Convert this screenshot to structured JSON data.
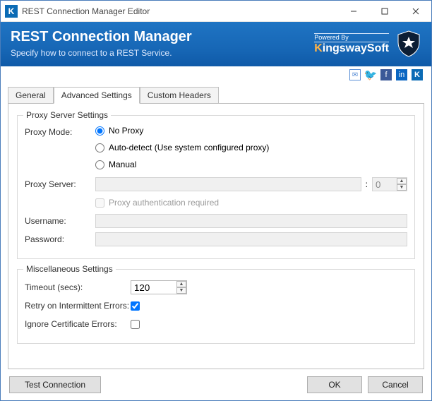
{
  "window": {
    "title": "REST Connection Manager Editor"
  },
  "header": {
    "title": "REST Connection Manager",
    "subtitle": "Specify how to connect to a REST Service.",
    "powered_prefix": "Powered By",
    "brand_accent": "K",
    "brand_rest": "ingswaySoft"
  },
  "tabs": {
    "general": "General",
    "advanced": "Advanced Settings",
    "custom": "Custom Headers"
  },
  "proxy": {
    "legend": "Proxy Server Settings",
    "mode_label": "Proxy Mode:",
    "opt_no_proxy": "No Proxy",
    "opt_autodetect": "Auto-detect (Use system configured proxy)",
    "opt_manual": "Manual",
    "server_label": "Proxy Server:",
    "server_value": "",
    "port_sep": ":",
    "port_value": "0",
    "auth_required": "Proxy authentication required",
    "username_label": "Username:",
    "username_value": "",
    "password_label": "Password:",
    "password_value": ""
  },
  "misc": {
    "legend": "Miscellaneous Settings",
    "timeout_label": "Timeout (secs):",
    "timeout_value": "120",
    "retry_label": "Retry on Intermittent Errors:",
    "ignore_label": "Ignore Certificate Errors:"
  },
  "buttons": {
    "test": "Test Connection",
    "ok": "OK",
    "cancel": "Cancel"
  }
}
